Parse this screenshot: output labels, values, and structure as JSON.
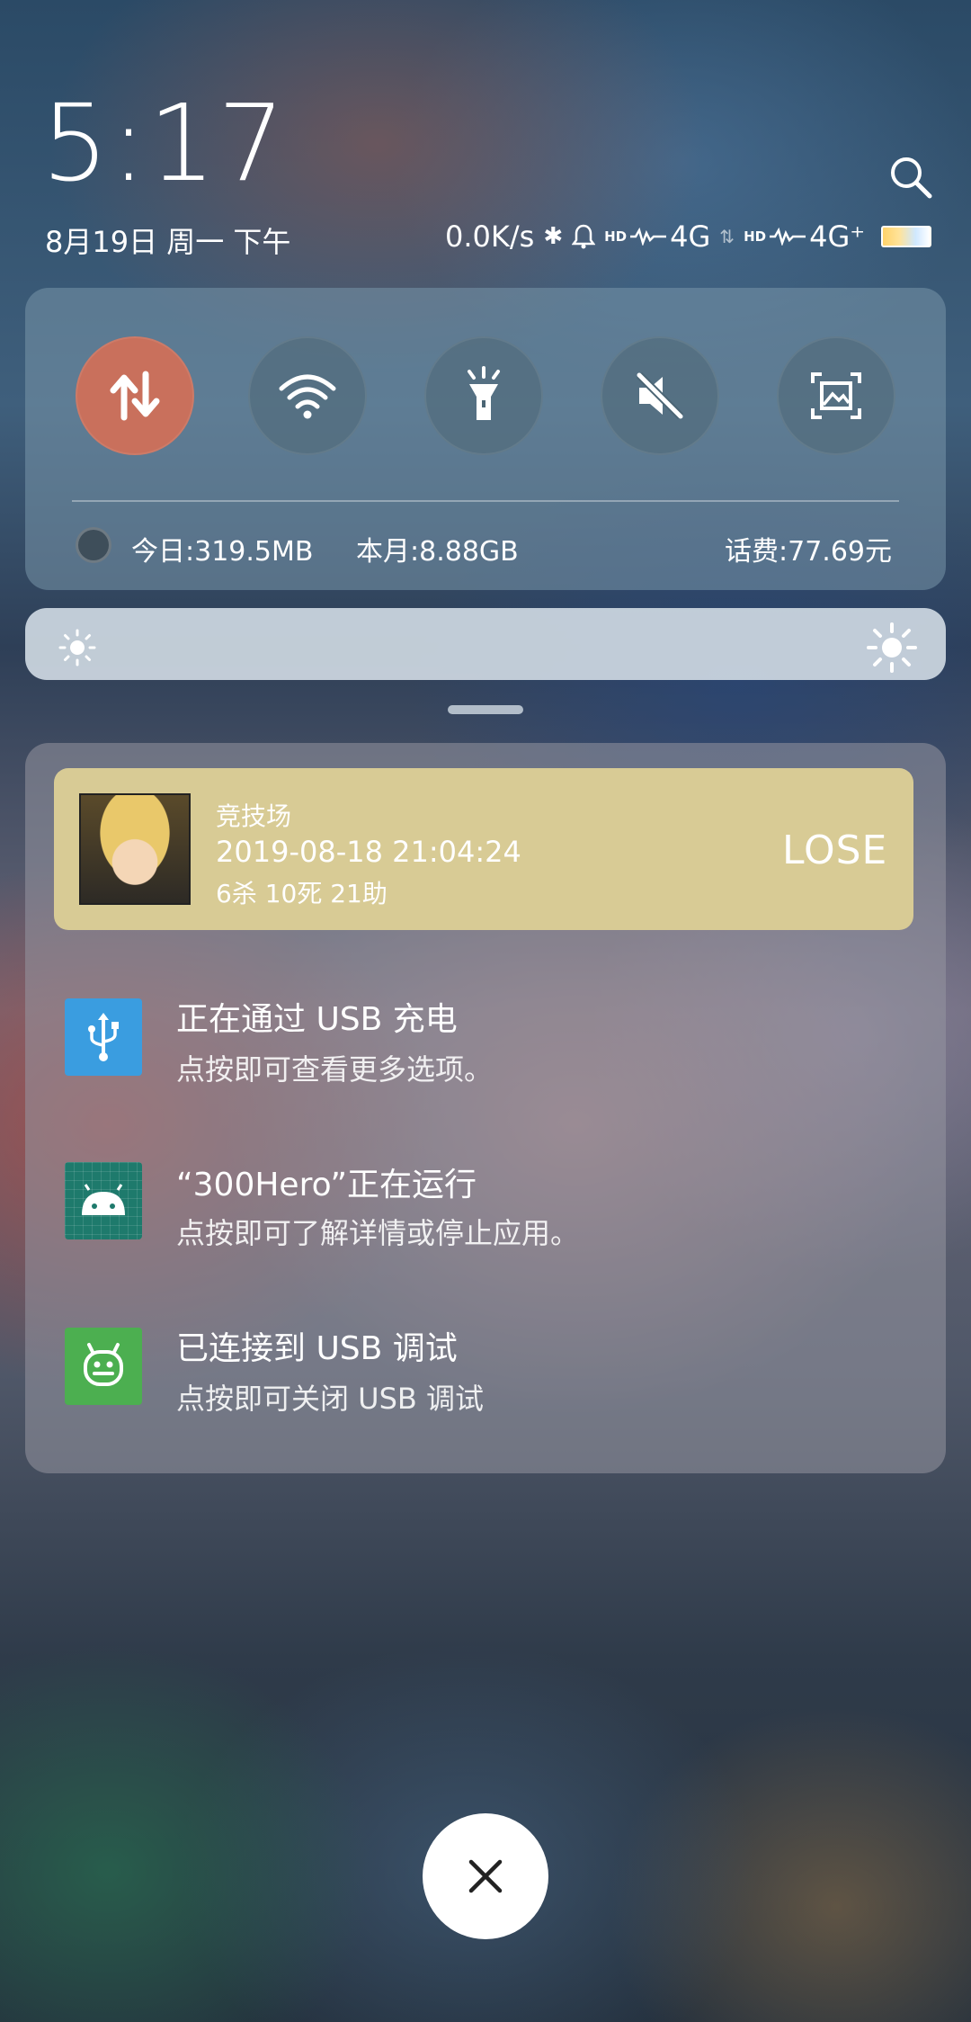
{
  "header": {
    "time": "5:17",
    "date": "8月19日 周一 下午",
    "net_speed": "0.0K/s",
    "sim1": {
      "badge": "HD",
      "type": "4G"
    },
    "sim2": {
      "badge": "HD",
      "type": "4G⁺"
    }
  },
  "quick_toggles": [
    {
      "name": "mobile-data",
      "icon": "data-arrows-icon",
      "active": true
    },
    {
      "name": "wifi",
      "icon": "wifi-icon",
      "active": false
    },
    {
      "name": "flashlight",
      "icon": "flashlight-icon",
      "active": false
    },
    {
      "name": "mute",
      "icon": "mute-icon",
      "active": false
    },
    {
      "name": "screenshot",
      "icon": "screenshot-icon",
      "active": false
    }
  ],
  "usage": {
    "today": "今日:319.5MB",
    "month": "本月:8.88GB",
    "balance": "话费:77.69元"
  },
  "game_notification": {
    "title": "竞技场",
    "time": "2019-08-18 21:04:24",
    "stats": "6杀 10死 21助",
    "result": "LOSE"
  },
  "notifications": [
    {
      "icon": "usb-icon",
      "icon_bg": "#3a9de0",
      "title": "正在通过 USB 充电",
      "subtitle": "点按即可查看更多选项。"
    },
    {
      "icon": "android-icon",
      "icon_bg": "#1e7a6c",
      "title": "“300Hero”正在运行",
      "subtitle": "点按即可了解详情或停止应用。"
    },
    {
      "icon": "android-debug-icon",
      "icon_bg": "#4caf50",
      "title": "已连接到 USB 调试",
      "subtitle": "点按即可关闭 USB 调试"
    }
  ],
  "colors": {
    "active_toggle": "#c9705c",
    "game_card": "#d8cb95"
  }
}
